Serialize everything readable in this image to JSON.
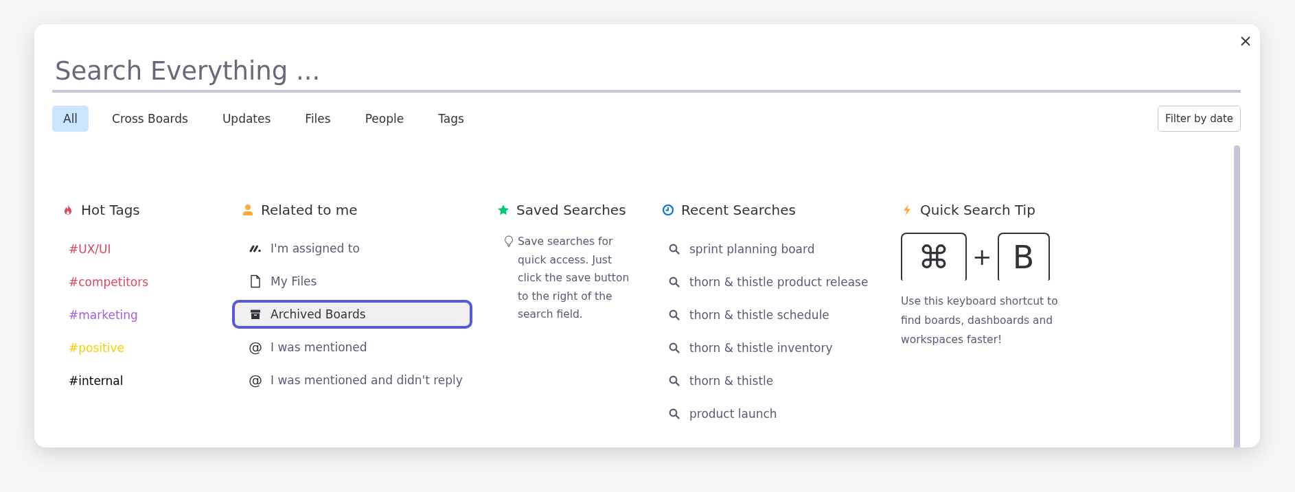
{
  "search": {
    "placeholder": "Search Everything ..."
  },
  "tabs": [
    {
      "label": "All",
      "selected": true
    },
    {
      "label": "Cross Boards",
      "selected": false
    },
    {
      "label": "Updates",
      "selected": false
    },
    {
      "label": "Files",
      "selected": false
    },
    {
      "label": "People",
      "selected": false
    },
    {
      "label": "Tags",
      "selected": false
    }
  ],
  "filter_button": "Filter by date",
  "hot_tags": {
    "title": "Hot Tags",
    "items": [
      {
        "label": "#UX/UI",
        "color": "#e2445c"
      },
      {
        "label": "#competitors",
        "color": "#e2445c"
      },
      {
        "label": "#marketing",
        "color": "#a25ddc"
      },
      {
        "label": "#positive",
        "color": "#ffcb00"
      },
      {
        "label": "#internal",
        "color": "#000000"
      }
    ]
  },
  "related": {
    "title": "Related to me",
    "items": [
      {
        "kind": "assigned",
        "label": "I'm assigned to",
        "selected": false
      },
      {
        "kind": "file",
        "label": "My Files",
        "selected": false
      },
      {
        "kind": "archive",
        "label": "Archived Boards",
        "selected": true
      },
      {
        "kind": "mention",
        "glyph": "@",
        "label": "I was mentioned",
        "selected": false
      },
      {
        "kind": "mention",
        "glyph": "@",
        "label": "I was mentioned and didn't reply",
        "selected": false
      }
    ]
  },
  "saved_searches": {
    "title": "Saved Searches",
    "hint": "Save searches for quick access. Just click the save button to the right of the search field."
  },
  "recent_searches": {
    "title": "Recent Searches",
    "items": [
      "sprint planning board",
      "thorn & thistle product release",
      "thorn & thistle schedule",
      "thorn & thistle inventory",
      "thorn & thistle",
      "product launch"
    ]
  },
  "quick_tip": {
    "title": "Quick Search Tip",
    "keys": [
      "⌘",
      "B"
    ],
    "joiner": "+",
    "text": "Use this keyboard shortcut to find boards, dashboards and workspaces faster!"
  }
}
